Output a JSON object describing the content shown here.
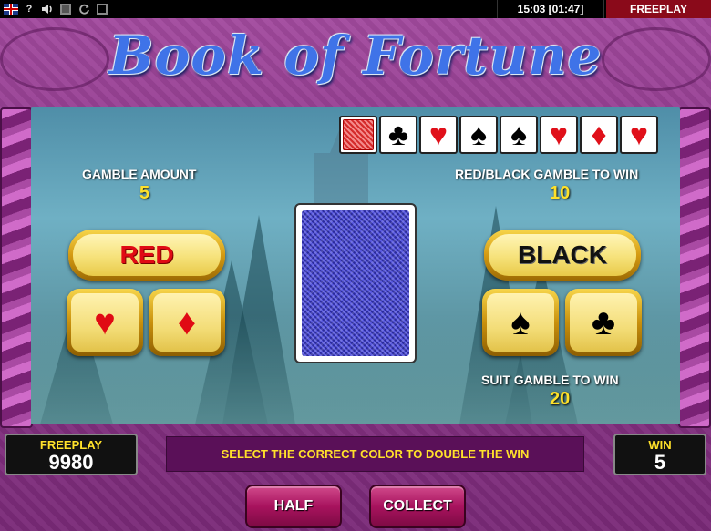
{
  "topbar": {
    "help_label": "?",
    "clock": "15:03 [01:47]",
    "mode": "FREEPLAY"
  },
  "logo": {
    "title": "Book of Fortune"
  },
  "history": {
    "cards": [
      {
        "suit": "back",
        "symbol": ""
      },
      {
        "suit": "black",
        "symbol": "♣"
      },
      {
        "suit": "red",
        "symbol": "♥"
      },
      {
        "suit": "black",
        "symbol": "♠"
      },
      {
        "suit": "black",
        "symbol": "♠"
      },
      {
        "suit": "red",
        "symbol": "♥"
      },
      {
        "suit": "red",
        "symbol": "♦"
      },
      {
        "suit": "red",
        "symbol": "♥"
      }
    ]
  },
  "gamble": {
    "amount_label": "GAMBLE AMOUNT",
    "amount_value": "5",
    "color_win_label": "RED/BLACK GAMBLE TO WIN",
    "color_win_value": "10",
    "suit_win_label": "SUIT GAMBLE TO WIN",
    "suit_win_value": "20"
  },
  "buttons": {
    "red": "RED",
    "black": "BLACK",
    "heart": "♥",
    "diamond": "♦",
    "spade": "♠",
    "club": "♣",
    "half": "HALF",
    "collect": "COLLECT"
  },
  "footer": {
    "balance_label": "FREEPLAY",
    "balance_value": "9980",
    "message": "SELECT THE CORRECT COLOR TO DOUBLE THE WIN",
    "win_label": "WIN",
    "win_value": "5"
  },
  "colors": {
    "accent_yellow": "#ffe12a",
    "red_suit": "#e00a14",
    "frame_purple": "#8b3588",
    "card_back_blue": "#2a2a9e"
  }
}
